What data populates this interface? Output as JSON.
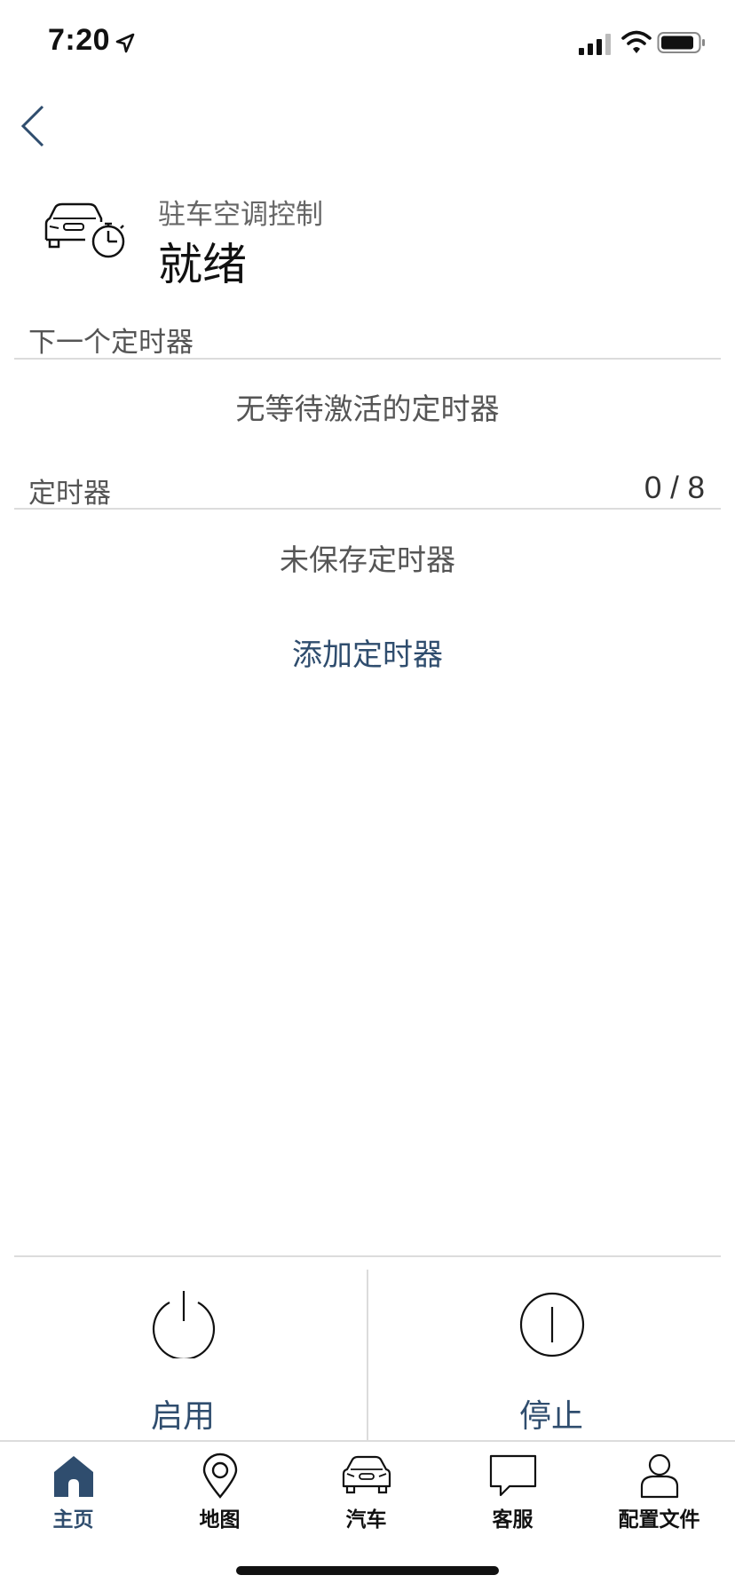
{
  "status_bar": {
    "time": "7:20"
  },
  "header": {
    "subtitle": "驻车空调控制",
    "title": "就绪"
  },
  "next_timer": {
    "label": "下一个定时器",
    "empty_text": "无等待激活的定时器"
  },
  "timers": {
    "label": "定时器",
    "count": "0 / 8",
    "empty_text": "未保存定时器",
    "add_label": "添加定时器"
  },
  "controls": {
    "start_label": "启用",
    "stop_label": "停止"
  },
  "tabbar": {
    "tabs": [
      {
        "label": "主页",
        "icon": "home-icon",
        "active": true
      },
      {
        "label": "地图",
        "icon": "map-pin-icon",
        "active": false
      },
      {
        "label": "汽车",
        "icon": "car-icon",
        "active": false
      },
      {
        "label": "客服",
        "icon": "chat-bubble-icon",
        "active": false
      },
      {
        "label": "配置文件",
        "icon": "profile-icon",
        "active": false
      }
    ]
  },
  "colors": {
    "accent": "#2f4d6e",
    "divider": "#dcdcdc",
    "text_secondary": "#555555"
  }
}
